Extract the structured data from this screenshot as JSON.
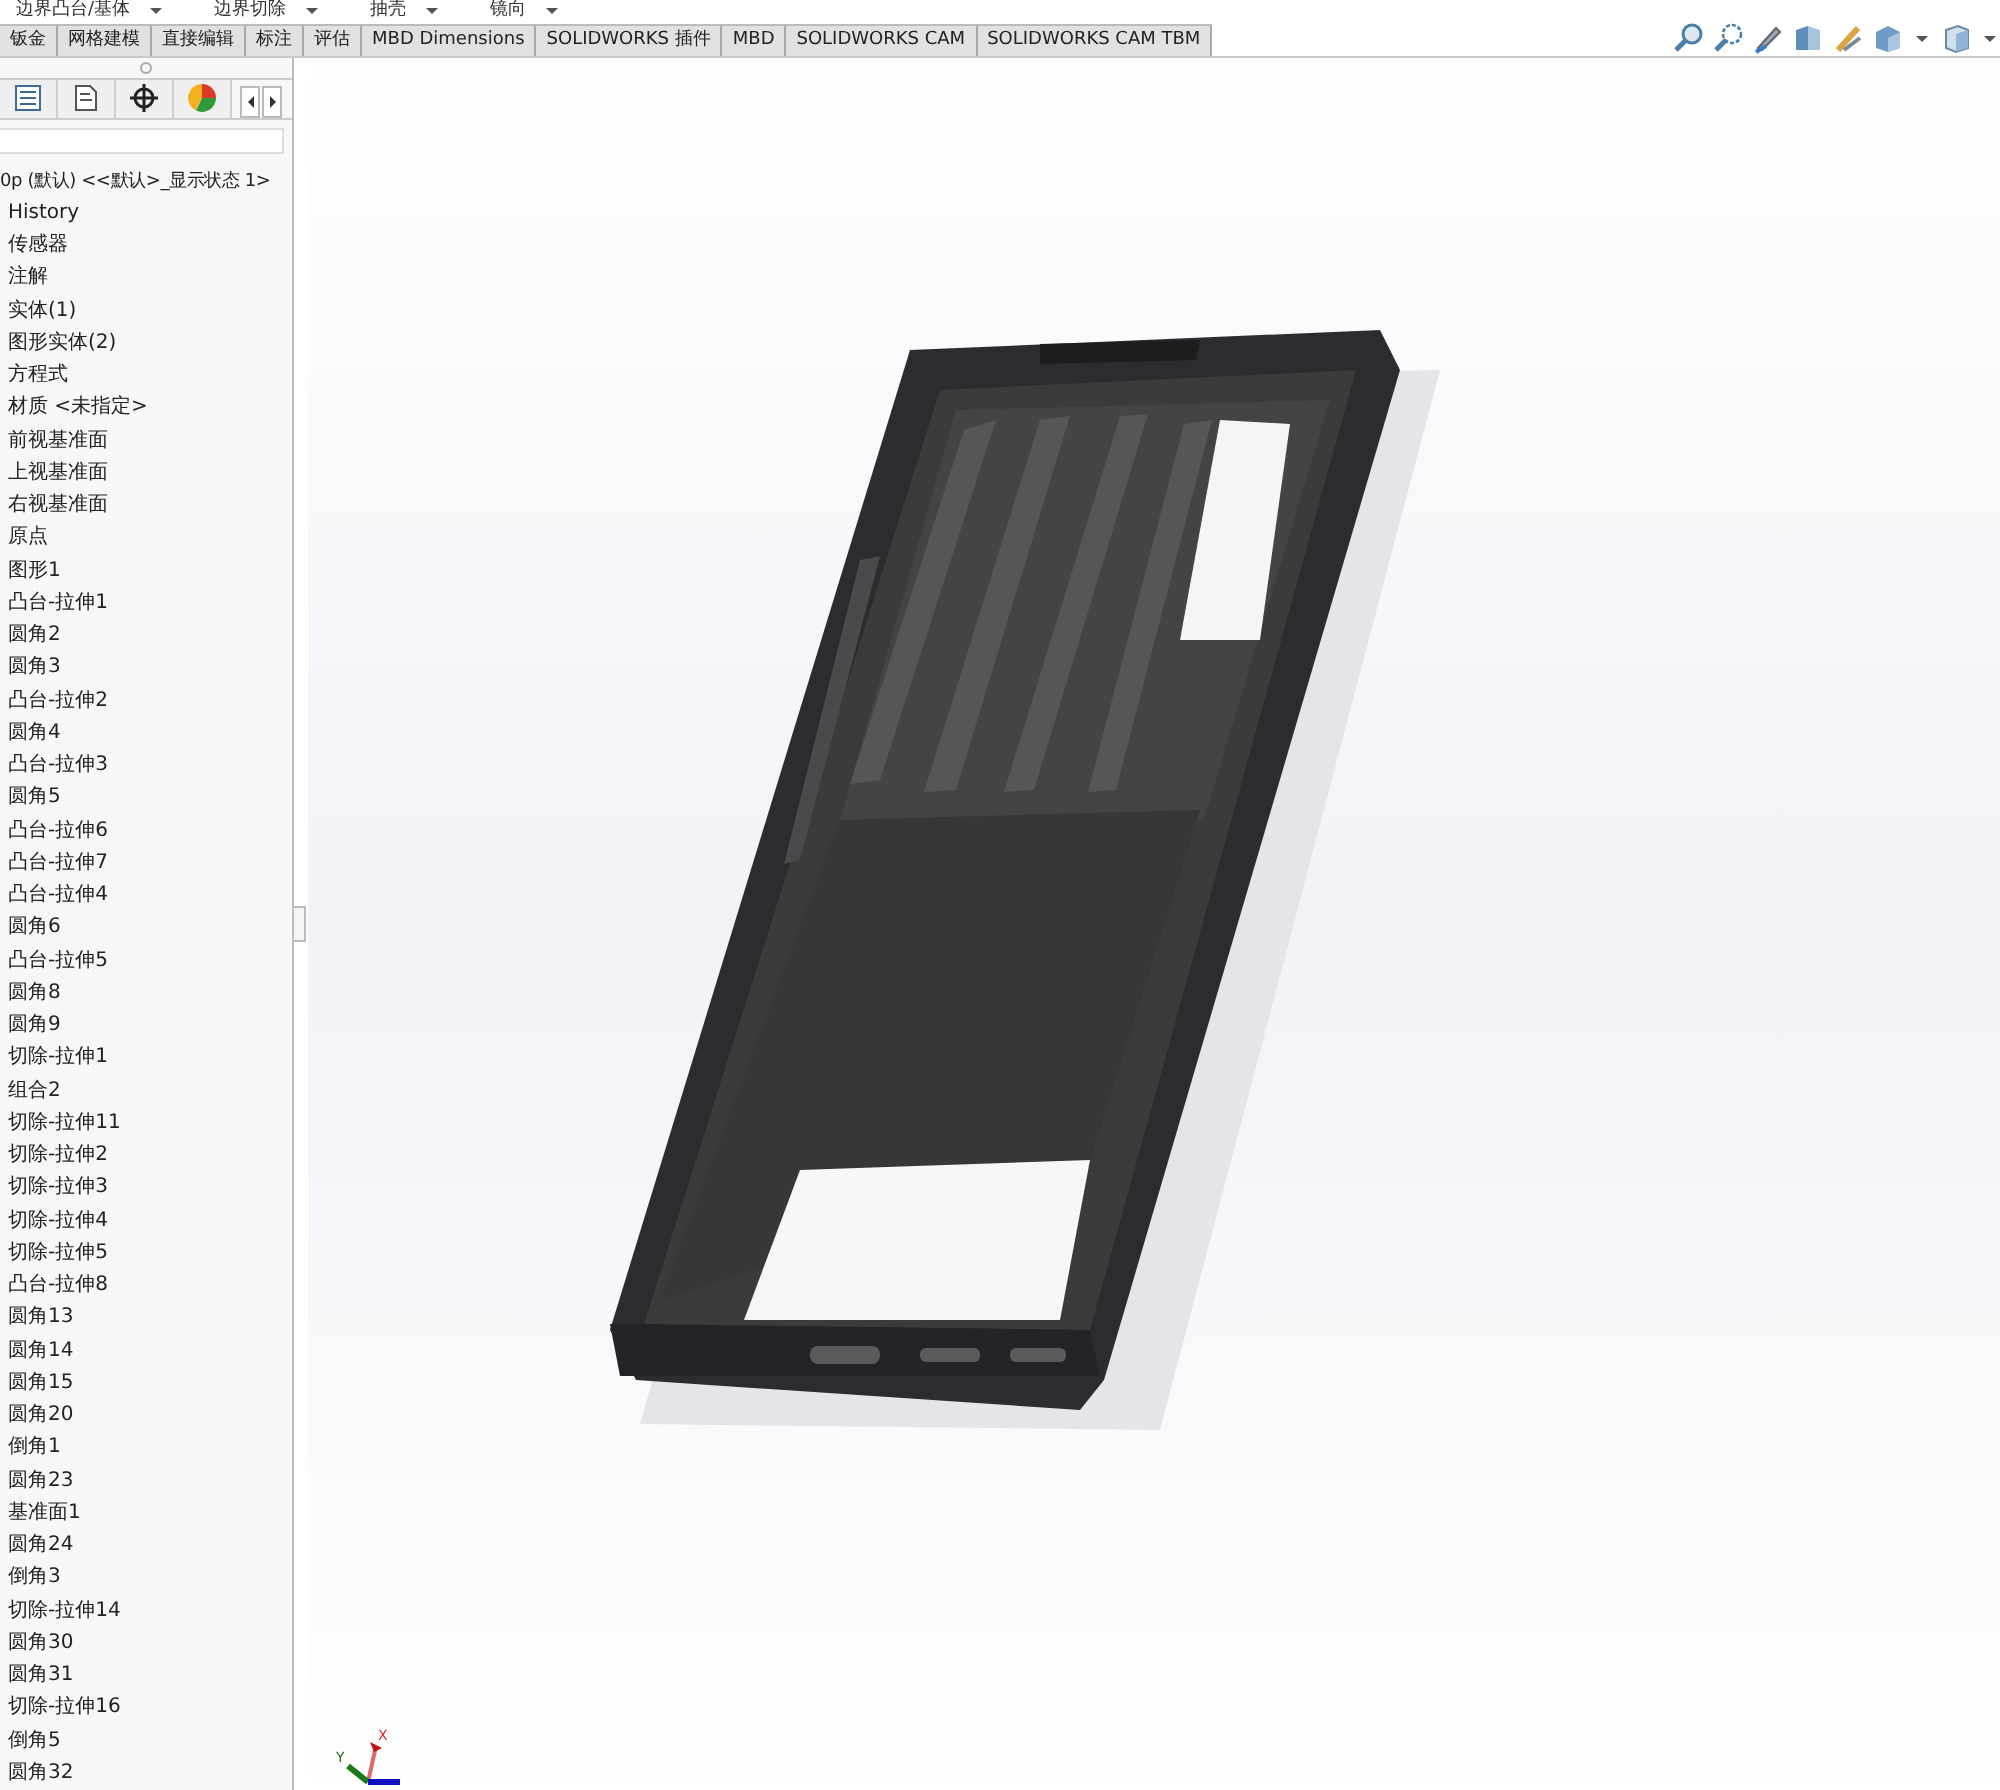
{
  "command_toolbar": [
    {
      "label": "边界凸台/基体"
    },
    {
      "label": "边界切除"
    },
    {
      "label": "抽壳"
    },
    {
      "label": "镜向"
    }
  ],
  "tabs": [
    {
      "label": "钣金",
      "selected": false
    },
    {
      "label": "网格建模",
      "selected": false
    },
    {
      "label": "直接编辑",
      "selected": false
    },
    {
      "label": "标注",
      "selected": false
    },
    {
      "label": "评估",
      "selected": false
    },
    {
      "label": "MBD Dimensions",
      "selected": false
    },
    {
      "label": "SOLIDWORKS 插件",
      "selected": false
    },
    {
      "label": "MBD",
      "selected": false
    },
    {
      "label": "SOLIDWORKS CAM",
      "selected": false
    },
    {
      "label": "SOLIDWORKS CAM TBM",
      "selected": false
    }
  ],
  "feature_tree": {
    "root": "0p (默认) <<默认>_显示状态 1>",
    "items": [
      "History",
      "传感器",
      "注解",
      "实体(1)",
      "图形实体(2)",
      "方程式",
      "材质 <未指定>",
      "前视基准面",
      "上视基准面",
      "右视基准面",
      "原点",
      "图形1",
      "凸台-拉伸1",
      "圆角2",
      "圆角3",
      "凸台-拉伸2",
      "圆角4",
      "凸台-拉伸3",
      "圆角5",
      "凸台-拉伸6",
      "凸台-拉伸7",
      "凸台-拉伸4",
      "圆角6",
      "凸台-拉伸5",
      "圆角8",
      "圆角9",
      "切除-拉伸1",
      "组合2",
      "切除-拉伸11",
      "切除-拉伸2",
      "切除-拉伸3",
      "切除-拉伸4",
      "切除-拉伸5",
      "凸台-拉伸8",
      "圆角13",
      "圆角14",
      "圆角15",
      "圆角20",
      "倒角1",
      "圆角23",
      "基准面1",
      "圆角24",
      "倒角3",
      "切除-拉伸14",
      "圆角30",
      "圆角31",
      "切除-拉伸16",
      "倒角5",
      "圆角32"
    ]
  },
  "viewport": {
    "axes": {
      "x": "X",
      "y": "Y"
    }
  }
}
